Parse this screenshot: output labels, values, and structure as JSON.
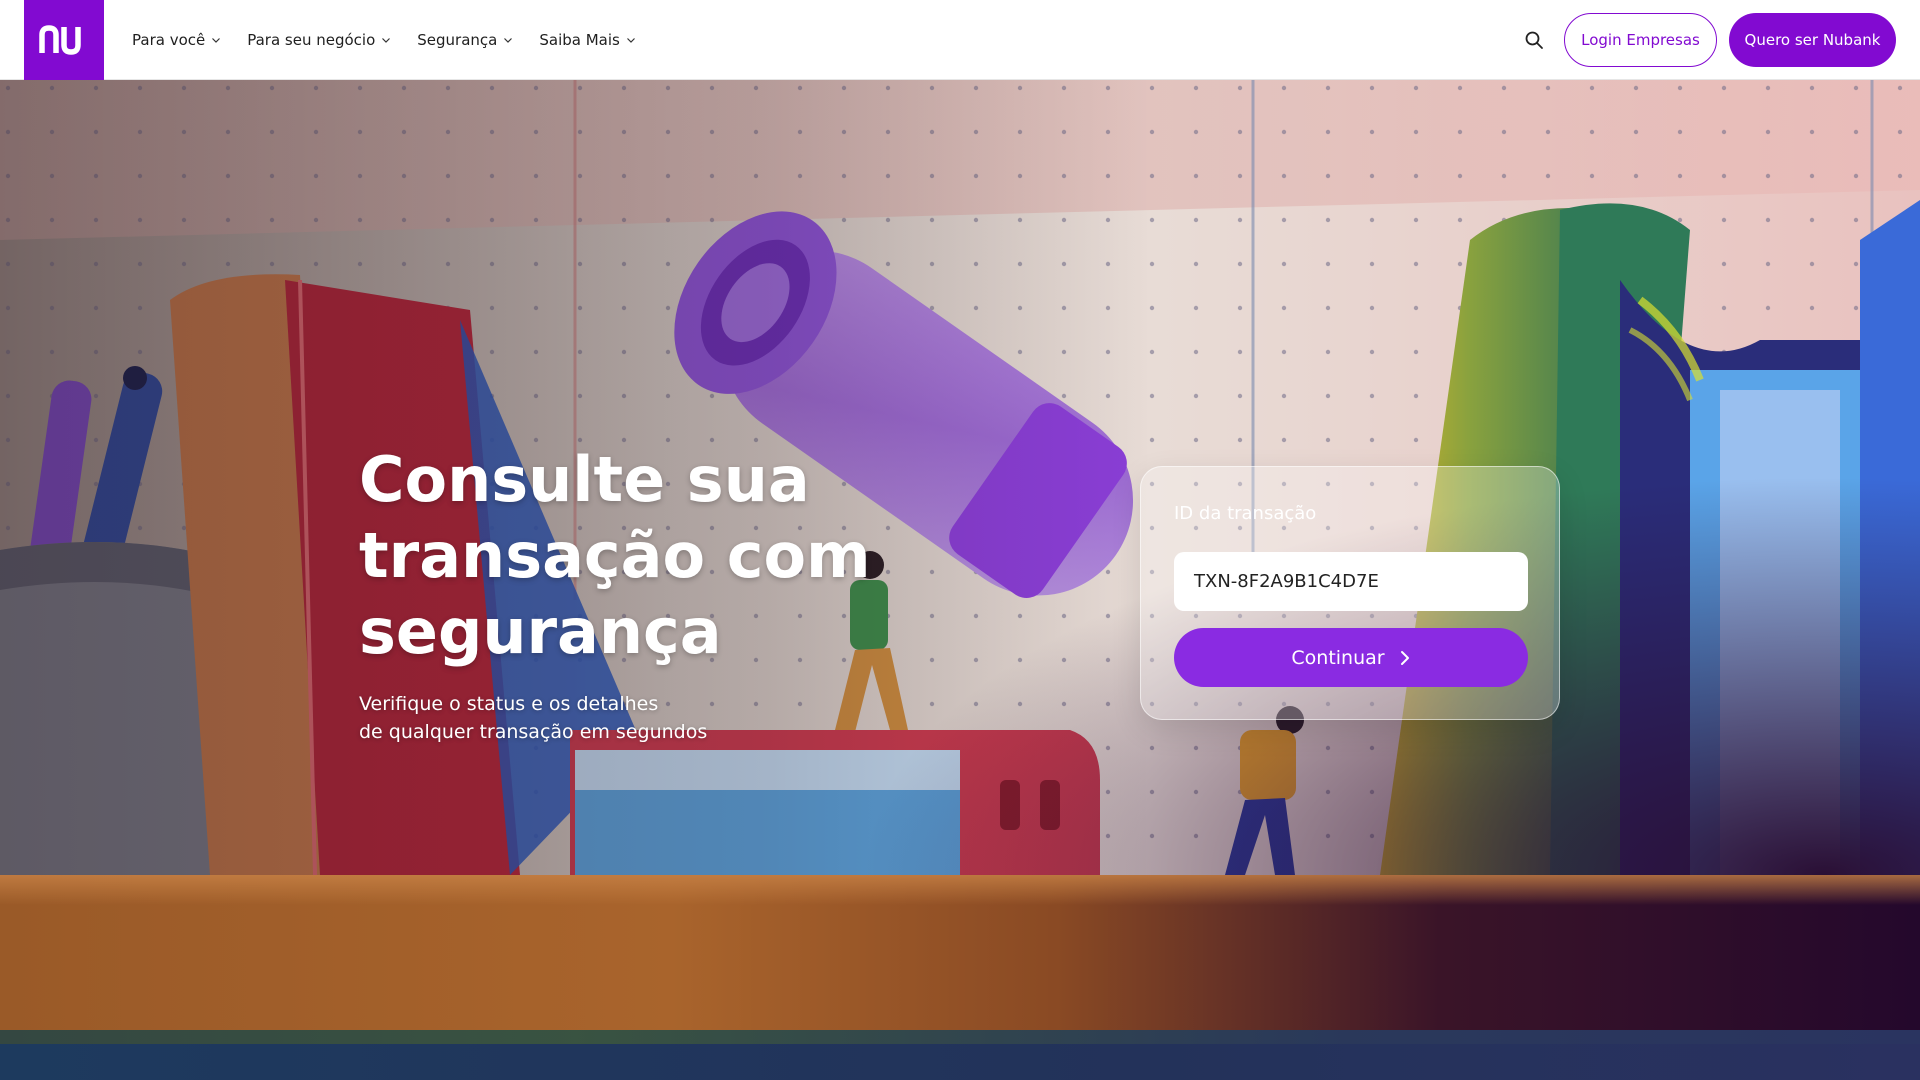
{
  "header": {
    "logo_text": "nu",
    "nav": [
      {
        "label": "Para você"
      },
      {
        "label": "Para seu negócio"
      },
      {
        "label": "Segurança"
      },
      {
        "label": "Saiba Mais"
      }
    ],
    "search_icon": "search-icon",
    "login_button": "Login Empresas",
    "signup_button": "Quero ser Nubank"
  },
  "hero": {
    "title": "Consulte sua transação com segurança",
    "subtitle_line1": "Verifique o status e os detalhes",
    "subtitle_line2": "de qualquer transação em segundos"
  },
  "form": {
    "label": "ID da transação",
    "input_value": "TXN-8F2A9B1C4D7E",
    "submit_label": "Continuar",
    "submit_icon": "chevron-right-icon"
  },
  "colors": {
    "brand": "#820ad1",
    "button": "#8a2be2",
    "header_bg": "#ffffff"
  }
}
